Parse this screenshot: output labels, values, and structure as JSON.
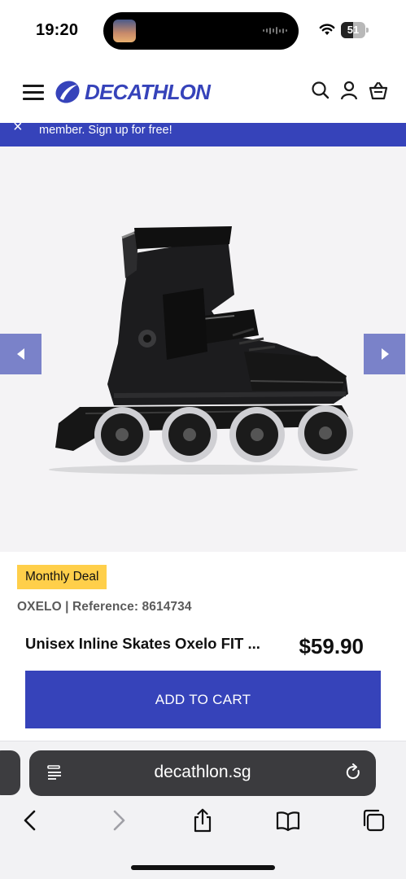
{
  "status_bar": {
    "time": "19:20",
    "battery": "51",
    "battery_level": 0.51
  },
  "header": {
    "logo_text": "DECATHLON"
  },
  "banner": {
    "close_glyph": "×",
    "text": "member. Sign up for free!"
  },
  "gallery": {
    "prev_icon": "chevron-left-icon",
    "next_icon": "chevron-right-icon"
  },
  "product": {
    "badge": "Monthly Deal",
    "brand_reference": "OXELO | Reference: 8614734",
    "title": "Unisex Inline Skates Oxelo FIT ...",
    "price": "$59.90",
    "add_to_cart_label": "ADD TO CART"
  },
  "browser": {
    "url": "decathlon.sg",
    "toolbar_icons": [
      "back-icon",
      "forward-icon",
      "share-icon",
      "bookmarks-icon",
      "tabs-icon"
    ]
  },
  "colors": {
    "brand": "#3643ba",
    "badge": "#ffcf4a",
    "arrow_bg": "#7a82c9"
  }
}
